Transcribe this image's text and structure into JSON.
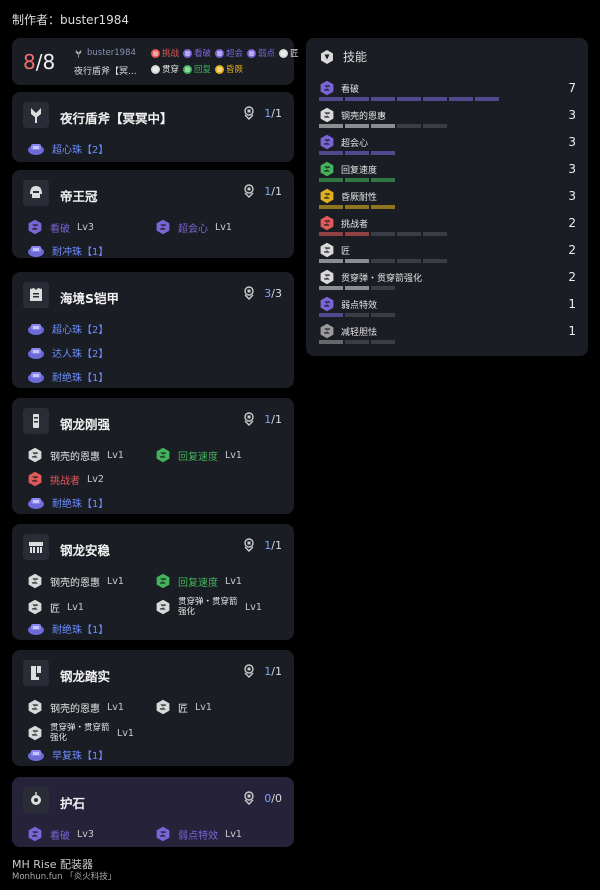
{
  "author": "制作者：buster1984",
  "summary": {
    "count_current": "8",
    "count_sep": "/",
    "count_total": "8",
    "user": "buster1984",
    "weapon": "夜行盾斧【冥...",
    "tags": [
      {
        "label": "挑战",
        "color": "#e05a5a"
      },
      {
        "label": "看破",
        "color": "#7a64d6"
      },
      {
        "label": "超会",
        "color": "#7a64d6"
      },
      {
        "label": "弱点",
        "color": "#7a64d6"
      },
      {
        "label": "匠",
        "color": "#d9d9d9"
      },
      {
        "label": "贯穿",
        "color": "#d9d9d9"
      },
      {
        "label": "回复",
        "color": "#43b25a"
      },
      {
        "label": "昏厥",
        "color": "#e0b020"
      }
    ]
  },
  "equipment": [
    {
      "name": "夜行盾斧【冥冥中】",
      "slot_used": "1",
      "slot_total": "/1",
      "icon": "weapon-icon",
      "lines": [
        [
          {
            "type": "deco",
            "label": "超心珠【2】"
          }
        ]
      ]
    },
    {
      "name": "帝王冠",
      "slot_used": "1",
      "slot_total": "/1",
      "icon": "helm-icon",
      "lines": [
        [
          {
            "type": "skill",
            "label": "看破",
            "lv": "Lv3",
            "color": "#7a64d6"
          },
          {
            "type": "skill",
            "label": "超会心",
            "lv": "Lv1",
            "color": "#7a64d6"
          }
        ],
        [
          {
            "type": "deco",
            "label": "耐冲珠【1】"
          }
        ]
      ]
    },
    {
      "name": "海境S铠甲",
      "slot_used": "3",
      "slot_total": "/3",
      "icon": "chest-icon",
      "lines": [
        [
          {
            "type": "deco",
            "label": "超心珠【2】"
          }
        ],
        [
          {
            "type": "deco",
            "label": "达人珠【2】"
          }
        ],
        [
          {
            "type": "deco",
            "label": "耐绝珠【1】"
          }
        ]
      ]
    },
    {
      "name": "钢龙刚强",
      "slot_used": "1",
      "slot_total": "/1",
      "icon": "arm-icon",
      "lines": [
        [
          {
            "type": "skill",
            "label": "钢壳的恩惠",
            "lv": "Lv1",
            "color": "#d9d9d9"
          },
          {
            "type": "skill",
            "label": "回复速度",
            "lv": "Lv1",
            "color": "#43b25a"
          }
        ],
        [
          {
            "type": "skill",
            "label": "挑战者",
            "lv": "Lv2",
            "color": "#e05a5a"
          }
        ],
        [
          {
            "type": "deco",
            "label": "耐绝珠【1】"
          }
        ]
      ]
    },
    {
      "name": "钢龙安稳",
      "slot_used": "1",
      "slot_total": "/1",
      "icon": "waist-icon",
      "lines": [
        [
          {
            "type": "skill",
            "label": "钢壳的恩惠",
            "lv": "Lv1",
            "color": "#d9d9d9"
          },
          {
            "type": "skill",
            "label": "回复速度",
            "lv": "Lv1",
            "color": "#43b25a"
          }
        ],
        [
          {
            "type": "skill",
            "label": "匠",
            "lv": "Lv1",
            "color": "#d9d9d9"
          },
          {
            "type": "skill2",
            "label": "贯穿弹・贯穿箭强化",
            "lv": "Lv1",
            "color": "#d9d9d9"
          }
        ],
        [
          {
            "type": "deco",
            "label": "耐绝珠【1】"
          }
        ]
      ]
    },
    {
      "name": "钢龙踏实",
      "slot_used": "1",
      "slot_total": "/1",
      "icon": "leg-icon",
      "lines": [
        [
          {
            "type": "skill",
            "label": "钢壳的恩惠",
            "lv": "Lv1",
            "color": "#d9d9d9"
          },
          {
            "type": "skill",
            "label": "匠",
            "lv": "Lv1",
            "color": "#d9d9d9"
          }
        ],
        [
          {
            "type": "skill2",
            "label": "贯穿弹・贯穿箭强化",
            "lv": "Lv1",
            "color": "#d9d9d9"
          }
        ],
        [
          {
            "type": "deco",
            "label": "早复珠【1】"
          }
        ]
      ]
    },
    {
      "name": "护石",
      "slot_used": "0",
      "slot_total": "/0",
      "icon": "charm-icon",
      "lines": [
        [
          {
            "type": "skill",
            "label": "看破",
            "lv": "Lv3",
            "color": "#7a64d6"
          },
          {
            "type": "skill",
            "label": "弱点特效",
            "lv": "Lv1",
            "color": "#7a64d6"
          }
        ]
      ]
    }
  ],
  "skills_header": "技能",
  "skills": [
    {
      "name": "看破",
      "level": 7,
      "max": 7,
      "color": "#7a64d6"
    },
    {
      "name": "钢壳的恩惠",
      "level": 3,
      "max": 5,
      "color": "#d9d9d9"
    },
    {
      "name": "超会心",
      "level": 3,
      "max": 3,
      "color": "#7a64d6"
    },
    {
      "name": "回复速度",
      "level": 3,
      "max": 3,
      "color": "#43b25a"
    },
    {
      "name": "昏厥耐性",
      "level": 3,
      "max": 3,
      "color": "#e0b020"
    },
    {
      "name": "挑战者",
      "level": 2,
      "max": 5,
      "color": "#e05a5a"
    },
    {
      "name": "匠",
      "level": 2,
      "max": 5,
      "color": "#d9d9d9"
    },
    {
      "name": "贯穿弹・贯穿箭强化",
      "level": 2,
      "max": 3,
      "color": "#d9d9d9"
    },
    {
      "name": "弱点特效",
      "level": 1,
      "max": 3,
      "color": "#7a64d6"
    },
    {
      "name": "减轻胆怯",
      "level": 1,
      "max": 3,
      "color": "#9a9a9a"
    }
  ],
  "footer": {
    "title": "MH Rise 配装器",
    "sub": "Monhun.fun 「炎火科技」"
  }
}
